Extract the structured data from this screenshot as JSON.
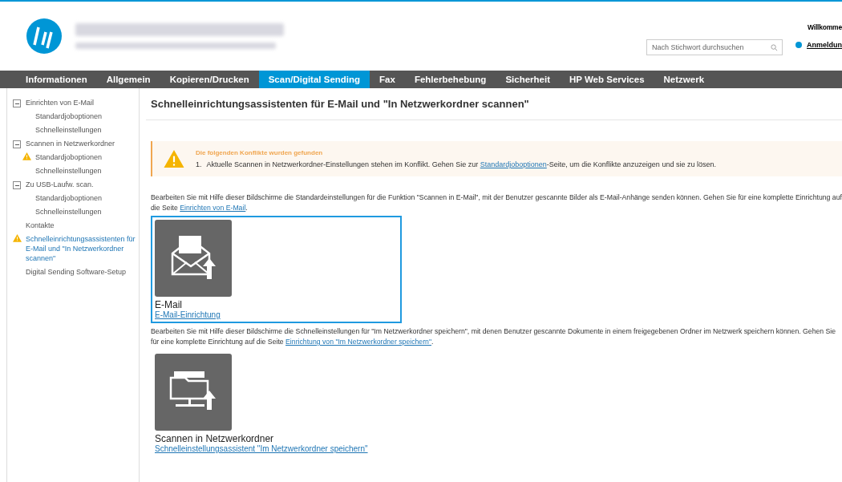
{
  "header": {
    "search": {
      "placeholder": "Nach Stichwort durchsuchen"
    },
    "welcome": "Willkomme",
    "login": "Anmeldun"
  },
  "nav": [
    {
      "label": "Informationen",
      "selected": false
    },
    {
      "label": "Allgemein",
      "selected": false
    },
    {
      "label": "Kopieren/Drucken",
      "selected": false
    },
    {
      "label": "Scan/Digital Sending",
      "selected": true
    },
    {
      "label": "Fax",
      "selected": false
    },
    {
      "label": "Fehlerbehebung",
      "selected": false
    },
    {
      "label": "Sicherheit",
      "selected": false
    },
    {
      "label": "HP Web Services",
      "selected": false
    },
    {
      "label": "Netzwerk",
      "selected": false
    }
  ],
  "sidebar": {
    "items": [
      {
        "label": "Einrichten von E-Mail",
        "expanded": true,
        "warning": false,
        "selected": false,
        "children": [
          {
            "label": "Standardjoboptionen",
            "warning": false,
            "selected": false
          },
          {
            "label": "Schnelleinstellungen",
            "warning": false,
            "selected": false
          }
        ]
      },
      {
        "label": "Scannen in Netzwerkordner",
        "expanded": true,
        "warning": false,
        "selected": false,
        "children": [
          {
            "label": "Standardjoboptionen",
            "warning": true,
            "selected": false
          },
          {
            "label": "Schnelleinstellungen",
            "warning": false,
            "selected": false
          }
        ]
      },
      {
        "label": "Zu USB-Laufw. scan.",
        "expanded": true,
        "warning": false,
        "selected": false,
        "children": [
          {
            "label": "Standardjoboptionen",
            "warning": false,
            "selected": false
          },
          {
            "label": "Schnelleinstellungen",
            "warning": false,
            "selected": false
          }
        ]
      },
      {
        "label": "Kontakte",
        "warning": false,
        "selected": false
      },
      {
        "label": "Schnelleinrichtungsassistenten für E-Mail und \"In Netzwerkordner scannen\"",
        "warning": true,
        "selected": true
      },
      {
        "label": "Digital Sending Software-Setup",
        "warning": false,
        "selected": false
      }
    ]
  },
  "page_title": "Schnelleinrichtungsassistenten für E-Mail und \"In Netzwerkordner scannen\"",
  "alert": {
    "title": "Die folgenden Konflikte wurden gefunden",
    "number": "1.",
    "text_before": "Aktuelle Scannen in Netzwerkordner-Einstellungen stehen im Konflikt. Gehen Sie zur",
    "link": "Standardjoboptionen",
    "text_after": "-Seite, um die Konflikte anzuzeigen und sie zu lösen."
  },
  "sections": [
    {
      "kind": "email",
      "text": "Bearbeiten Sie mit Hilfe dieser Bildschirme die Standardeinstellungen für die Funktion \"Scannen in E-Mail\", mit der Benutzer gescannte Bilder als E-Mail-Anhänge senden können. Gehen Sie für eine komplette Einrichtung auf die Seite",
      "link": "Einrichten von E-Mail",
      "after": ".",
      "title": "E-Mail",
      "action": "E-Mail-Einrichtung",
      "selected": true
    },
    {
      "kind": "folder",
      "text": "Bearbeiten Sie mit Hilfe dieser Bildschirme die Schnelleinstellungen für \"Im Netzwerkordner speichern\", mit denen Benutzer gescannte Dokumente in einem freigegebenen Ordner im Netzwerk speichern können. Gehen Sie für eine komplette Einrichtung auf die Seite",
      "link": "Einrichtung von \"Im Netzwerkordner speichern\"",
      "after": ".",
      "title": "Scannen in Netzwerkordner",
      "action": "Schnelleinstellungsassistent \"Im Netzwerkordner speichern\"",
      "selected": false
    }
  ]
}
